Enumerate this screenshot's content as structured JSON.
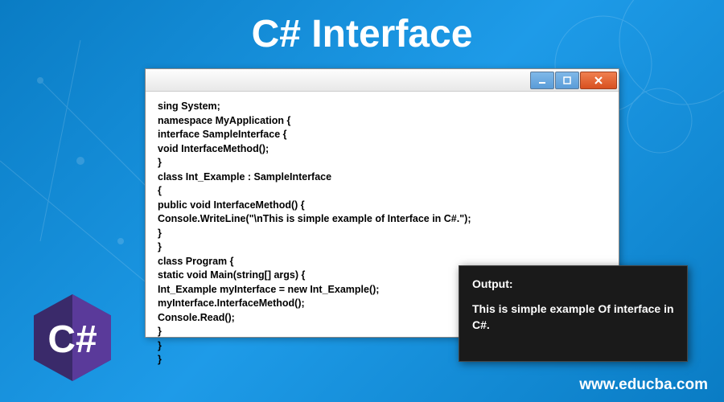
{
  "title": "C# Interface",
  "window": {
    "code": "sing System;\nnamespace MyApplication {\ninterface SampleInterface {\nvoid InterfaceMethod();\n}\nclass Int_Example : SampleInterface\n{\npublic void InterfaceMethod() {\nConsole.WriteLine(\"\\nThis is simple example of Interface in C#.\");\n}\n}\nclass Program {\nstatic void Main(string[] args) {\nInt_Example myInterface = new Int_Example();\nmyInterface.InterfaceMethod();\nConsole.Read();\n}\n}\n}"
  },
  "output": {
    "label": "Output:",
    "text": "This is simple example Of interface in C#."
  },
  "website": "www.educba.com",
  "logo": {
    "text": "C#"
  }
}
